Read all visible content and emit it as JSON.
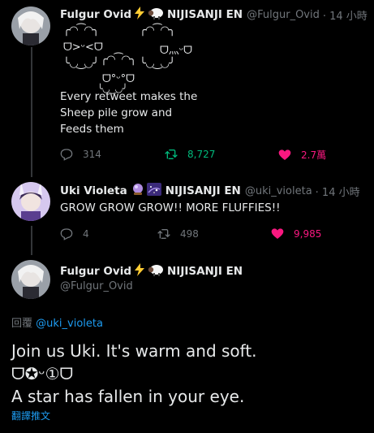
{
  "tweets": [
    {
      "author_name": "Fulgur Ovid",
      "author_tag": "NIJISANJI EN",
      "handle": "@Fulgur_Ovid",
      "time": "· 14 小時",
      "kaomoji": {
        "top_left": "╭◜◝ ͡ ◜◝╮",
        "top_right": "╭◜◝ ͡ ◜◝╮",
        "left_face": "ᗜ>ᵕ<ᗜ",
        "right_face": "ᗜ灬ᵕᗜ",
        "mid_left": "╰◟◞ ͜ ◟◞╯",
        "mid_center": "╭◜◝ ͡ ◜◝╮",
        "mid_right": "╰◟◞ ͜ ◟◞╯",
        "bottom_face": "ᗜ°ᵕ°ᗜ",
        "bottom": "╰◟◞ ͜ ◟◞╯"
      },
      "text_lines": [
        "Every retweet makes the",
        "Sheep pile grow and",
        "Feeds them"
      ],
      "replies": "314",
      "retweets": "8,727",
      "likes": "2.7萬"
    },
    {
      "author_name": "Uki Violeta",
      "author_tag": "NIJISANJI EN",
      "handle": "@uki_violeta",
      "time": "· 14 小時",
      "text": "GROW GROW GROW!! MORE FLUFFIES!!",
      "replies": "4",
      "retweets": "498",
      "likes": "9,985"
    }
  ],
  "main_tweet": {
    "author_name": "Fulgur Ovid",
    "author_tag": "NIJISANJI EN",
    "handle": "@Fulgur_Ovid",
    "reply_prefix": "回覆",
    "reply_to": "@uki_violeta",
    "lines": [
      "Join us Uki. It's warm and soft.",
      "ᗜ✪ᵕ①ᗜ",
      "A star has fallen in your eye."
    ],
    "translate": "翻譯推文"
  },
  "colors": {
    "retweet_active": "#00ba7c",
    "like_active": "#f91880",
    "link": "#1d9bf0"
  },
  "icons": [
    "lightning-emoji",
    "sheep-emoji",
    "crystal-ball-emoji",
    "galaxy-emoji",
    "reply-icon",
    "retweet-icon",
    "heart-icon"
  ]
}
